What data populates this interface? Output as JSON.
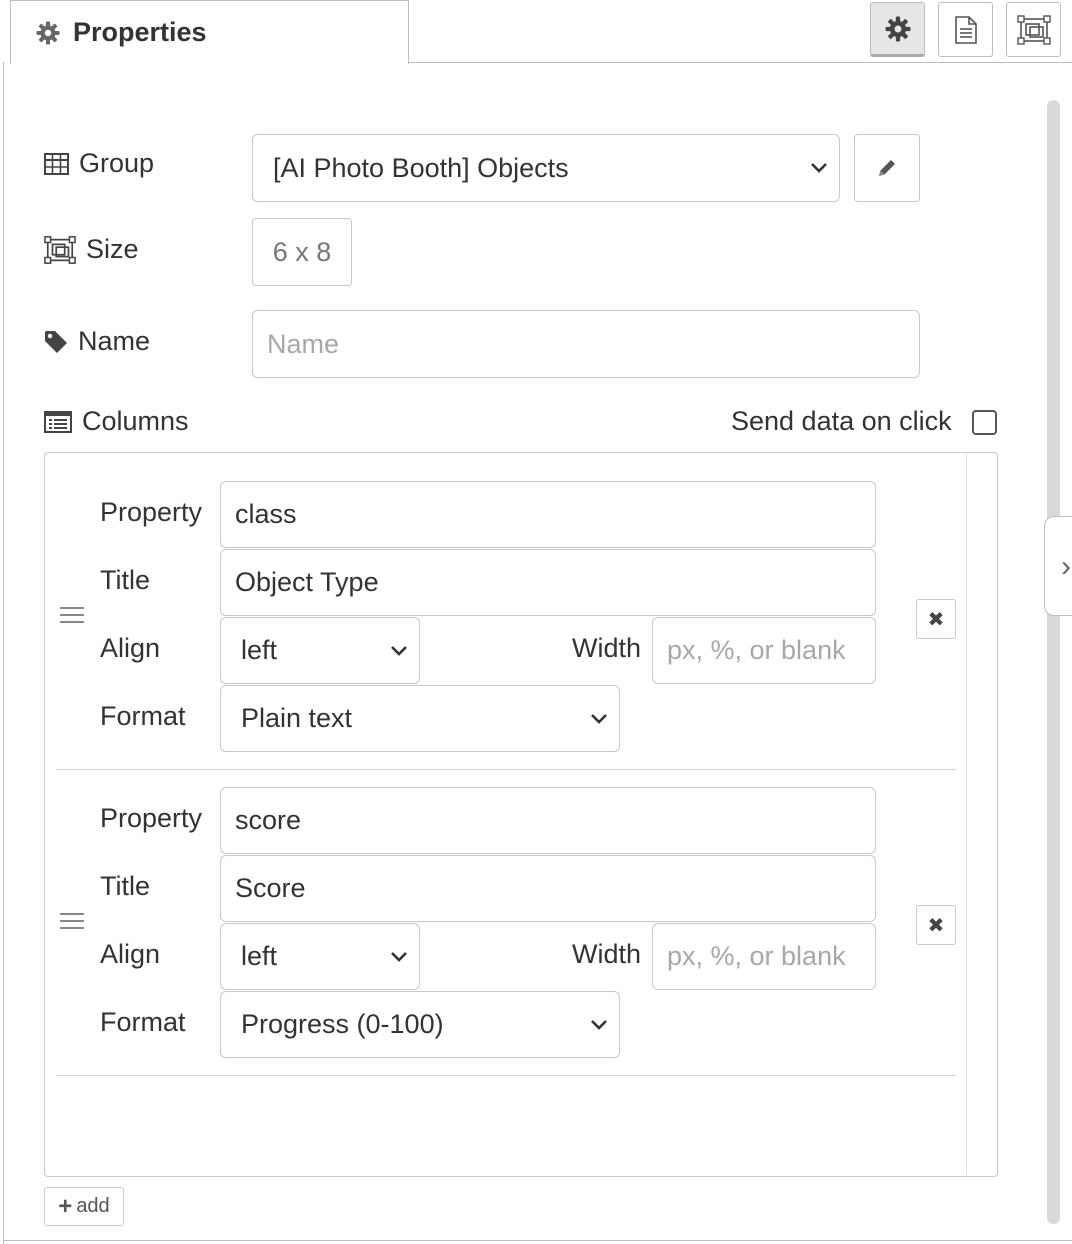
{
  "tab": {
    "title": "Properties"
  },
  "toolbar": {
    "buttons": [
      "settings",
      "description",
      "appearance"
    ]
  },
  "form": {
    "group": {
      "label": "Group",
      "value": "[AI Photo Booth] Objects"
    },
    "size": {
      "label": "Size",
      "value": "6 x 8"
    },
    "name": {
      "label": "Name",
      "placeholder": "Name",
      "value": ""
    },
    "columns": {
      "label": "Columns"
    },
    "send_on_click": {
      "label": "Send data on click",
      "checked": false
    }
  },
  "columns": [
    {
      "property_label": "Property",
      "property": "class",
      "title_label": "Title",
      "title": "Object Type",
      "align_label": "Align",
      "align": "left",
      "width_label": "Width",
      "width_placeholder": "px, %, or blank",
      "format_label": "Format",
      "format": "Plain text"
    },
    {
      "property_label": "Property",
      "property": "score",
      "title_label": "Title",
      "title": "Score",
      "align_label": "Align",
      "align": "left",
      "width_label": "Width",
      "width_placeholder": "px, %, or blank",
      "format_label": "Format",
      "format": "Progress (0-100)"
    }
  ],
  "add_button": {
    "label": "add"
  },
  "colors": {
    "border": "#c8c8c8",
    "text": "#333333",
    "placeholder": "#a8a8a8",
    "active_button": "#e6e6e6"
  }
}
